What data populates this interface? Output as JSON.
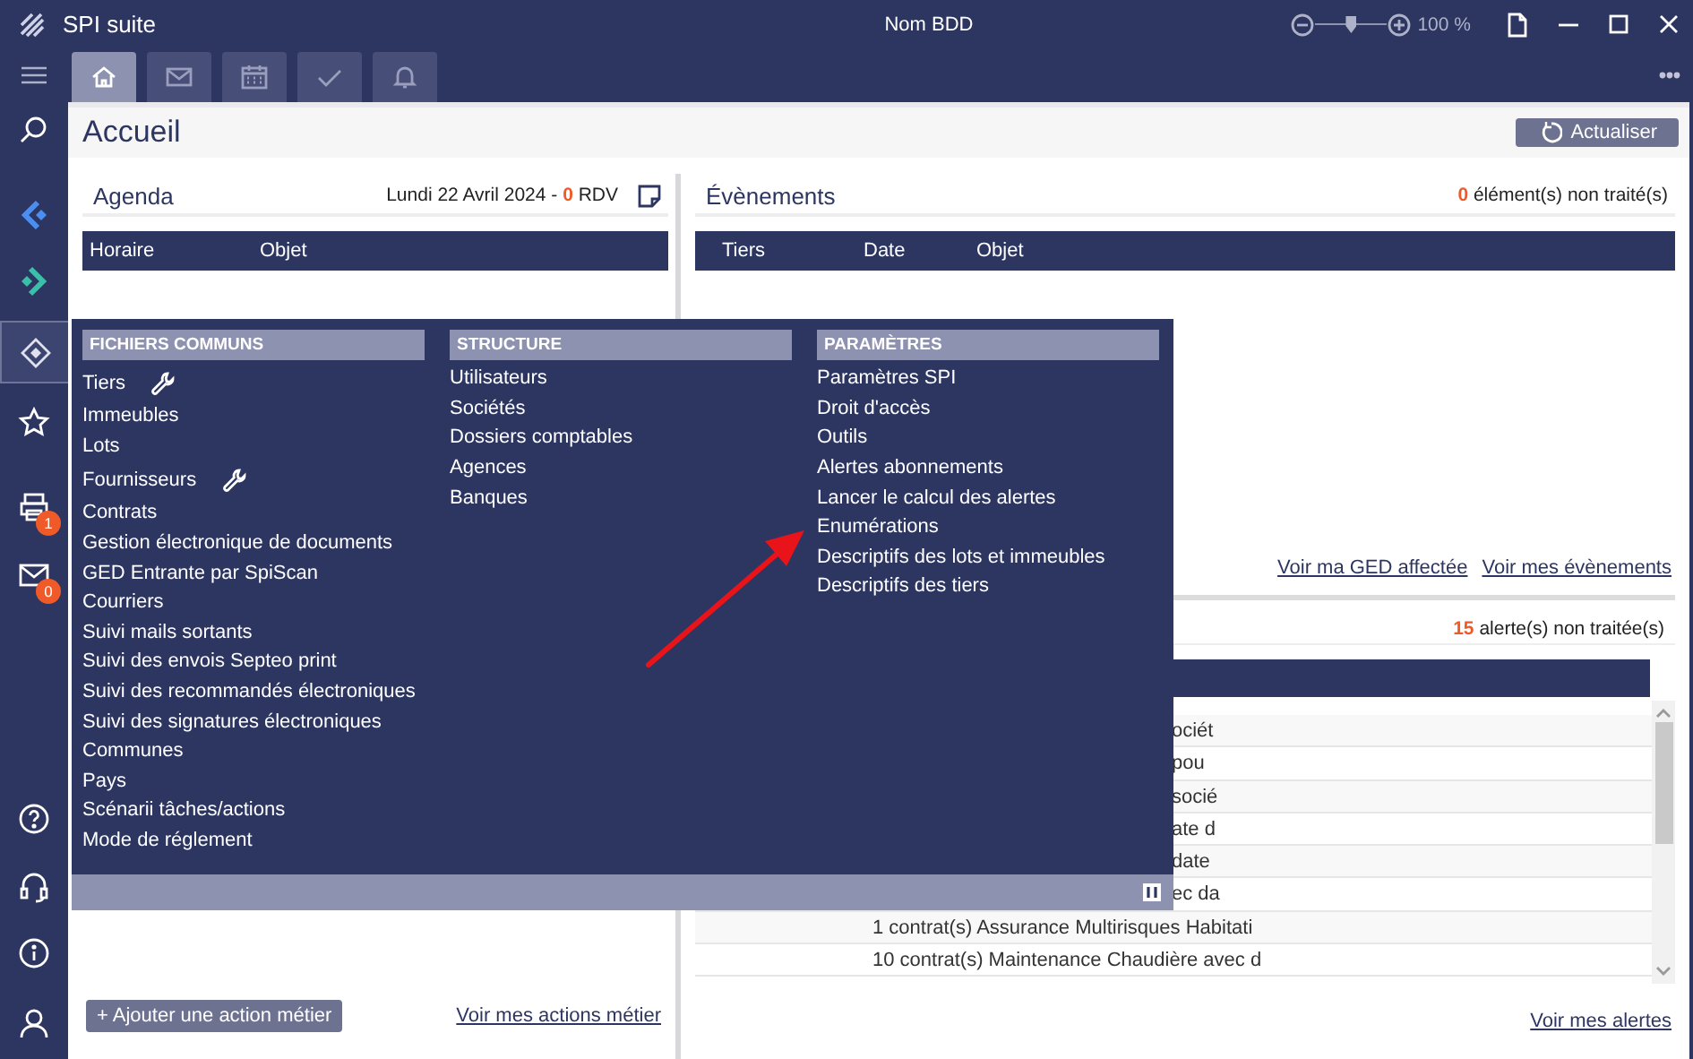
{
  "window": {
    "title": "SPI suite",
    "database_label": "Nom BDD",
    "zoom": {
      "level": 0.5,
      "reading": "100 %"
    }
  },
  "tabs": [
    {
      "selected": true
    },
    {
      "selected": false
    },
    {
      "selected": false
    },
    {
      "selected": false
    },
    {
      "selected": false
    }
  ],
  "sidebar": {
    "items": [
      {
        "active": false
      },
      {
        "active": false
      },
      {
        "active": false
      },
      {
        "active": true
      },
      {
        "active": false
      },
      {
        "active": false,
        "badge": "1"
      },
      {
        "active": false,
        "badge": "0"
      },
      {
        "active": false
      },
      {
        "active": false
      },
      {
        "active": false
      },
      {
        "active": false
      }
    ]
  },
  "page": {
    "title": "Accueil",
    "refresh_button": "Actualiser"
  },
  "agenda": {
    "title": "Agenda",
    "summary": "Lundi 22 Avril 2024 - **0** RDV",
    "columns": [
      "Horaire",
      "Objet"
    ],
    "add_button": "+ Ajouter une action métier",
    "link": "Voir mes actions métier"
  },
  "events": {
    "title": "Évènements",
    "summary": "**0** élément(s) non traité(s)",
    "columns": [
      "Tiers",
      "Date",
      "Objet"
    ],
    "links": [
      "Voir ma GED affectée",
      "Voir mes évènements"
    ]
  },
  "alerts": {
    "summary": "**15** alerte(s) non traitée(s)",
    "rows": [
      {
        "text": "ociét",
        "kind": "covered"
      },
      {
        "text": "pou",
        "kind": "covered"
      },
      {
        "text": "socié",
        "kind": "covered"
      },
      {
        "text": "ate d",
        "kind": "covered"
      },
      {
        "text": "date",
        "kind": "covered"
      },
      {
        "text": "ec da",
        "kind": "covered"
      },
      {
        "text": "1 contrat(s) Assurance Multirisques Habitati",
        "kind": "full"
      },
      {
        "text": "10 contrat(s) Maintenance Chaudière avec d",
        "kind": "full"
      }
    ],
    "link": "Voir mes alertes"
  },
  "menu": {
    "columns": [
      {
        "title": "FICHIERS COMMUNS",
        "items": [
          {
            "label": "Tiers",
            "tool": true
          },
          {
            "label": "Immeubles",
            "tool": false
          },
          {
            "label": "Lots",
            "tool": false
          },
          {
            "label": "Fournisseurs",
            "tool": true
          },
          {
            "label": "Contrats",
            "tool": false
          },
          {
            "label": "Gestion électronique de documents",
            "tool": false
          },
          {
            "label": "GED Entrante par SpiScan",
            "tool": false
          },
          {
            "label": "Courriers",
            "tool": false
          },
          {
            "label": "Suivi mails sortants",
            "tool": false
          },
          {
            "label": "Suivi des envois Septeo print",
            "tool": false
          },
          {
            "label": "Suivi des recommandés électroniques",
            "tool": false
          },
          {
            "label": "Suivi des signatures électroniques",
            "tool": false
          },
          {
            "label": "Communes",
            "tool": false
          },
          {
            "label": "Pays",
            "tool": false
          },
          {
            "label": "Scénarii tâches/actions",
            "tool": false
          },
          {
            "label": "Mode de réglement",
            "tool": false
          }
        ]
      },
      {
        "title": "STRUCTURE",
        "items": [
          {
            "label": "Utilisateurs",
            "tool": false
          },
          {
            "label": "Sociétés",
            "tool": false
          },
          {
            "label": "Dossiers comptables",
            "tool": false
          },
          {
            "label": "Agences",
            "tool": false
          },
          {
            "label": "Banques",
            "tool": false
          }
        ]
      },
      {
        "title": "PARAMÈTRES",
        "items": [
          {
            "label": "Paramètres SPI",
            "tool": false
          },
          {
            "label": "Droit d'accès",
            "tool": false
          },
          {
            "label": "Outils",
            "tool": false
          },
          {
            "label": "Alertes abonnements",
            "tool": false
          },
          {
            "label": "Lancer le calcul des alertes",
            "tool": false
          },
          {
            "label": "Enumérations",
            "tool": false
          },
          {
            "label": "Descriptifs des lots et immeubles",
            "tool": false
          },
          {
            "label": "Descriptifs des tiers",
            "tool": false
          }
        ]
      }
    ]
  }
}
